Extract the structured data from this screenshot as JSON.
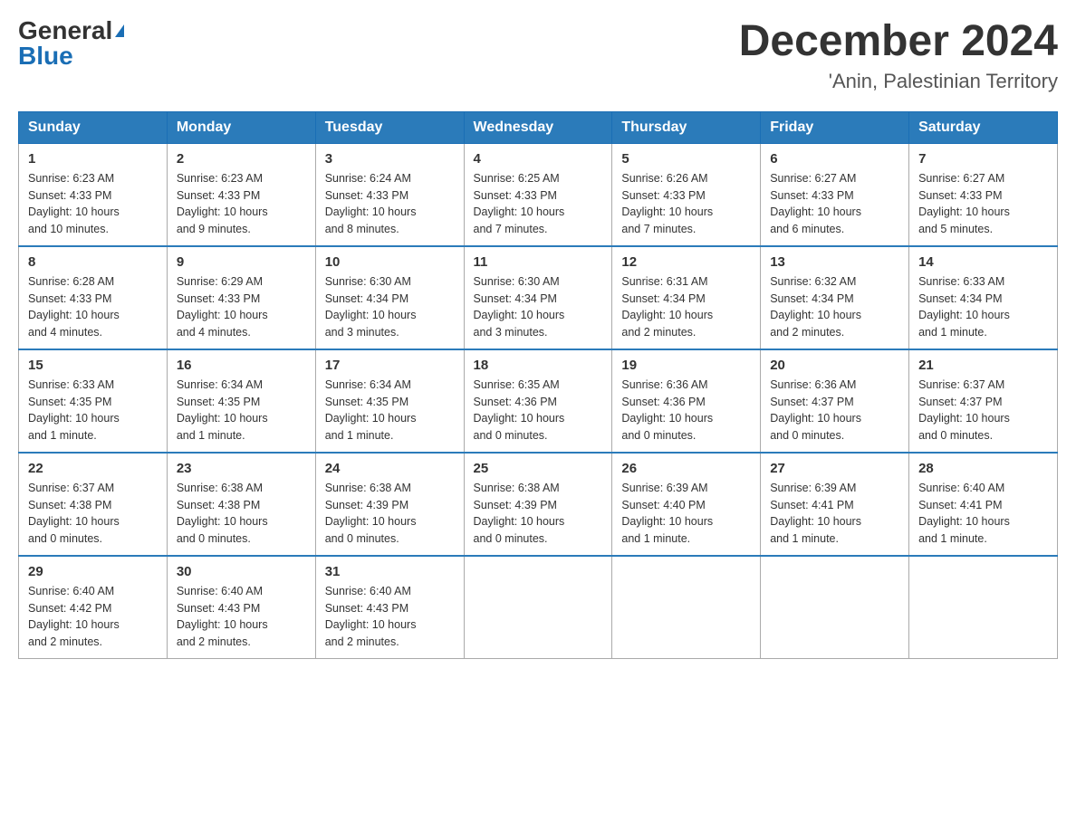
{
  "header": {
    "logo_general": "General",
    "logo_blue": "Blue",
    "month_title": "December 2024",
    "location": "'Anin, Palestinian Territory"
  },
  "days_of_week": [
    "Sunday",
    "Monday",
    "Tuesday",
    "Wednesday",
    "Thursday",
    "Friday",
    "Saturday"
  ],
  "weeks": [
    [
      {
        "day": "1",
        "sunrise": "6:23 AM",
        "sunset": "4:33 PM",
        "daylight": "10 hours and 10 minutes."
      },
      {
        "day": "2",
        "sunrise": "6:23 AM",
        "sunset": "4:33 PM",
        "daylight": "10 hours and 9 minutes."
      },
      {
        "day": "3",
        "sunrise": "6:24 AM",
        "sunset": "4:33 PM",
        "daylight": "10 hours and 8 minutes."
      },
      {
        "day": "4",
        "sunrise": "6:25 AM",
        "sunset": "4:33 PM",
        "daylight": "10 hours and 7 minutes."
      },
      {
        "day": "5",
        "sunrise": "6:26 AM",
        "sunset": "4:33 PM",
        "daylight": "10 hours and 7 minutes."
      },
      {
        "day": "6",
        "sunrise": "6:27 AM",
        "sunset": "4:33 PM",
        "daylight": "10 hours and 6 minutes."
      },
      {
        "day": "7",
        "sunrise": "6:27 AM",
        "sunset": "4:33 PM",
        "daylight": "10 hours and 5 minutes."
      }
    ],
    [
      {
        "day": "8",
        "sunrise": "6:28 AM",
        "sunset": "4:33 PM",
        "daylight": "10 hours and 4 minutes."
      },
      {
        "day": "9",
        "sunrise": "6:29 AM",
        "sunset": "4:33 PM",
        "daylight": "10 hours and 4 minutes."
      },
      {
        "day": "10",
        "sunrise": "6:30 AM",
        "sunset": "4:34 PM",
        "daylight": "10 hours and 3 minutes."
      },
      {
        "day": "11",
        "sunrise": "6:30 AM",
        "sunset": "4:34 PM",
        "daylight": "10 hours and 3 minutes."
      },
      {
        "day": "12",
        "sunrise": "6:31 AM",
        "sunset": "4:34 PM",
        "daylight": "10 hours and 2 minutes."
      },
      {
        "day": "13",
        "sunrise": "6:32 AM",
        "sunset": "4:34 PM",
        "daylight": "10 hours and 2 minutes."
      },
      {
        "day": "14",
        "sunrise": "6:33 AM",
        "sunset": "4:34 PM",
        "daylight": "10 hours and 1 minute."
      }
    ],
    [
      {
        "day": "15",
        "sunrise": "6:33 AM",
        "sunset": "4:35 PM",
        "daylight": "10 hours and 1 minute."
      },
      {
        "day": "16",
        "sunrise": "6:34 AM",
        "sunset": "4:35 PM",
        "daylight": "10 hours and 1 minute."
      },
      {
        "day": "17",
        "sunrise": "6:34 AM",
        "sunset": "4:35 PM",
        "daylight": "10 hours and 1 minute."
      },
      {
        "day": "18",
        "sunrise": "6:35 AM",
        "sunset": "4:36 PM",
        "daylight": "10 hours and 0 minutes."
      },
      {
        "day": "19",
        "sunrise": "6:36 AM",
        "sunset": "4:36 PM",
        "daylight": "10 hours and 0 minutes."
      },
      {
        "day": "20",
        "sunrise": "6:36 AM",
        "sunset": "4:37 PM",
        "daylight": "10 hours and 0 minutes."
      },
      {
        "day": "21",
        "sunrise": "6:37 AM",
        "sunset": "4:37 PM",
        "daylight": "10 hours and 0 minutes."
      }
    ],
    [
      {
        "day": "22",
        "sunrise": "6:37 AM",
        "sunset": "4:38 PM",
        "daylight": "10 hours and 0 minutes."
      },
      {
        "day": "23",
        "sunrise": "6:38 AM",
        "sunset": "4:38 PM",
        "daylight": "10 hours and 0 minutes."
      },
      {
        "day": "24",
        "sunrise": "6:38 AM",
        "sunset": "4:39 PM",
        "daylight": "10 hours and 0 minutes."
      },
      {
        "day": "25",
        "sunrise": "6:38 AM",
        "sunset": "4:39 PM",
        "daylight": "10 hours and 0 minutes."
      },
      {
        "day": "26",
        "sunrise": "6:39 AM",
        "sunset": "4:40 PM",
        "daylight": "10 hours and 1 minute."
      },
      {
        "day": "27",
        "sunrise": "6:39 AM",
        "sunset": "4:41 PM",
        "daylight": "10 hours and 1 minute."
      },
      {
        "day": "28",
        "sunrise": "6:40 AM",
        "sunset": "4:41 PM",
        "daylight": "10 hours and 1 minute."
      }
    ],
    [
      {
        "day": "29",
        "sunrise": "6:40 AM",
        "sunset": "4:42 PM",
        "daylight": "10 hours and 2 minutes."
      },
      {
        "day": "30",
        "sunrise": "6:40 AM",
        "sunset": "4:43 PM",
        "daylight": "10 hours and 2 minutes."
      },
      {
        "day": "31",
        "sunrise": "6:40 AM",
        "sunset": "4:43 PM",
        "daylight": "10 hours and 2 minutes."
      },
      null,
      null,
      null,
      null
    ]
  ],
  "labels": {
    "sunrise_prefix": "Sunrise: ",
    "sunset_prefix": "Sunset: ",
    "daylight_prefix": "Daylight: "
  }
}
